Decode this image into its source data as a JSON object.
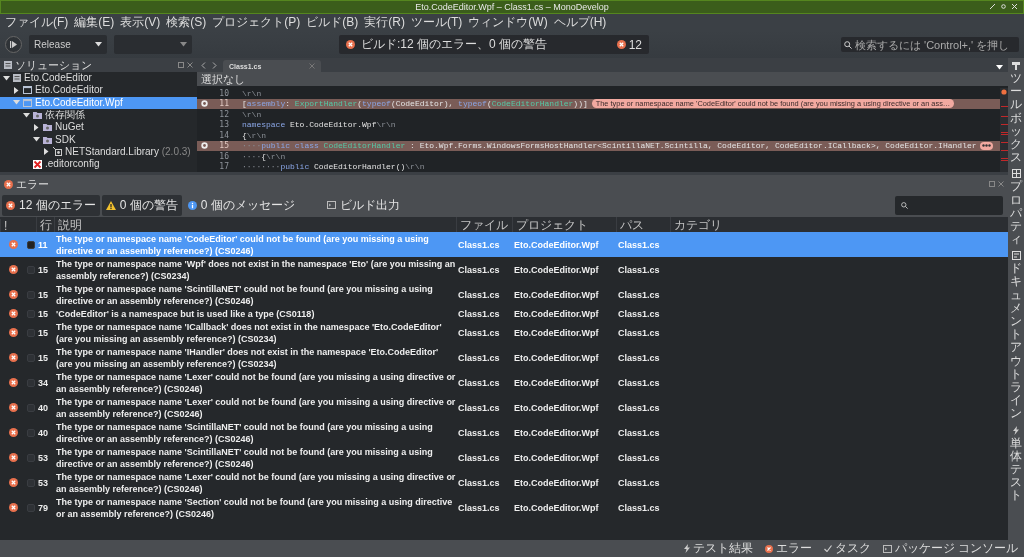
{
  "window": {
    "title": "Eto.CodeEditor.Wpf – Class1.cs – MonoDevelop"
  },
  "menu": [
    "ファイル(F)",
    "編集(E)",
    "表示(V)",
    "検索(S)",
    "プロジェクト(P)",
    "ビルド(B)",
    "実行(R)",
    "ツール(T)",
    "ウィンドウ(W)",
    "ヘルプ(H)"
  ],
  "toolbar": {
    "configuration": "Release",
    "status": {
      "text": "ビルド:12 個のエラー、0 個の警告",
      "error_count": "12"
    },
    "search": {
      "placeholder": "検索するには 'Control+,' を押し"
    }
  },
  "solution_pad": {
    "title": "ソリューション",
    "tree": [
      {
        "label": "Eto.CodeEditor",
        "kind": "solution",
        "expanded": true,
        "selected": false,
        "children": [
          {
            "label": "Eto.CodeEditor",
            "kind": "project",
            "expanded": false,
            "selected": false
          },
          {
            "label": "Eto.CodeEditor.Wpf",
            "kind": "project",
            "expanded": true,
            "selected": true,
            "children": [
              {
                "label": "依存関係",
                "kind": "folder",
                "expanded": true,
                "selected": false,
                "children": [
                  {
                    "label": "NuGet",
                    "kind": "folder",
                    "expanded": false,
                    "selected": false
                  },
                  {
                    "label": "SDK",
                    "kind": "folder",
                    "expanded": true,
                    "selected": false,
                    "children": [
                      {
                        "label": "NETStandard.Library",
                        "version": "(2.0.3)",
                        "kind": "package",
                        "expanded": false,
                        "selected": false
                      }
                    ]
                  }
                ]
              },
              {
                "label": ".editorconfig",
                "kind": "file",
                "selected": false
              }
            ]
          }
        ]
      }
    ]
  },
  "editor": {
    "tabs": [
      {
        "label": "Class1.cs",
        "selected": true
      }
    ],
    "breadcrumb": "選択なし",
    "lines": [
      {
        "number": "10",
        "error": false,
        "tokens": [
          {
            "text": "\\r\\n",
            "kind": "eol"
          }
        ]
      },
      {
        "number": "11",
        "error": true,
        "tokens": [
          {
            "text": "[",
            "kind": "plain"
          },
          {
            "text": "assembly",
            "kind": "kw"
          },
          {
            "text": ": ",
            "kind": "plain"
          },
          {
            "text": "ExportHandler",
            "kind": "type"
          },
          {
            "text": "(",
            "kind": "plain"
          },
          {
            "text": "typeof",
            "kind": "kw"
          },
          {
            "text": "(CodeEditor), ",
            "kind": "plain"
          },
          {
            "text": "typeof",
            "kind": "kw"
          },
          {
            "text": "(",
            "kind": "plain"
          },
          {
            "text": "CodeEditorHandler",
            "kind": "type"
          },
          {
            "text": "))]",
            "kind": "plain"
          }
        ],
        "bubble": {
          "collapsed": false,
          "text": "The type or namespace name 'CodeEditor' could not be found (are you missing a using directive or an ass…"
        }
      },
      {
        "number": "12",
        "error": false,
        "tokens": [
          {
            "text": "\\r\\n",
            "kind": "eol"
          }
        ]
      },
      {
        "number": "13",
        "error": false,
        "tokens": [
          {
            "text": "namespace",
            "kind": "kw"
          },
          {
            "text": " Eto.CodeEditor.Wpf",
            "kind": "plain"
          },
          {
            "text": "\\r\\n",
            "kind": "eol"
          }
        ]
      },
      {
        "number": "14",
        "error": false,
        "tokens": [
          {
            "text": "{",
            "kind": "plain"
          },
          {
            "text": "\\r\\n",
            "kind": "eol"
          }
        ]
      },
      {
        "number": "15",
        "error": true,
        "tokens": [
          {
            "text": "····",
            "kind": "ws"
          },
          {
            "text": "public class",
            "kind": "kw"
          },
          {
            "text": " CodeEditorHandler",
            "kind": "type"
          },
          {
            "text": " : Eto.Wpf.Forms.WindowsFormsHostHandler<ScintillaNET.Scintilla, CodeEditor, CodeEditor.ICallback>, CodeEditor.IHandler",
            "kind": "plain"
          }
        ],
        "bubble": {
          "collapsed": true
        }
      },
      {
        "number": "16",
        "error": false,
        "tokens": [
          {
            "text": "····",
            "kind": "ws"
          },
          {
            "text": "{",
            "kind": "plain"
          },
          {
            "text": "\\r\\n",
            "kind": "eol"
          }
        ]
      },
      {
        "number": "17",
        "error": false,
        "tokens": [
          {
            "text": "········",
            "kind": "ws"
          },
          {
            "text": "public",
            "kind": "kw"
          },
          {
            "text": " CodeEditorHandler()",
            "kind": "plain"
          },
          {
            "text": "\\r\\n",
            "kind": "eol"
          }
        ]
      }
    ]
  },
  "errors_pad": {
    "title": "エラー",
    "filters": [
      {
        "label": "12 個のエラー",
        "kind": "error",
        "selected": true
      },
      {
        "label": "0 個の警告",
        "kind": "warning",
        "selected": true
      },
      {
        "label": "0 個のメッセージ",
        "kind": "info",
        "selected": false
      }
    ],
    "build_output": "ビルド出力",
    "columns": [
      "!",
      "行",
      "説明",
      "ファイル",
      "プロジェクト",
      "パス",
      "カテゴリ"
    ],
    "rows": [
      {
        "line": "11",
        "description": "The type or namespace name 'CodeEditor' could not be found (are you missing a using directive or an assembly reference?) (CS0246)",
        "file": "Class1.cs",
        "project": "Eto.CodeEditor.Wpf",
        "path": "Class1.cs",
        "checked": false,
        "selected": true
      },
      {
        "line": "15",
        "description": "The type or namespace name 'Wpf' does not exist in the namespace 'Eto' (are you missing an assembly reference?) (CS0234)",
        "file": "Class1.cs",
        "project": "Eto.CodeEditor.Wpf",
        "path": "Class1.cs",
        "checked": false,
        "selected": false
      },
      {
        "line": "15",
        "description": "The type or namespace name 'ScintillaNET' could not be found (are you missing a using directive or an assembly reference?) (CS0246)",
        "file": "Class1.cs",
        "project": "Eto.CodeEditor.Wpf",
        "path": "Class1.cs",
        "checked": false,
        "selected": false
      },
      {
        "line": "15",
        "description": "'CodeEditor' is a namespace but is used like a type (CS0118)",
        "file": "Class1.cs",
        "project": "Eto.CodeEditor.Wpf",
        "path": "Class1.cs",
        "checked": false,
        "selected": false
      },
      {
        "line": "15",
        "description": "The type or namespace name 'ICallback' does not exist in the namespace 'Eto.CodeEditor' (are you missing an assembly reference?) (CS0234)",
        "file": "Class1.cs",
        "project": "Eto.CodeEditor.Wpf",
        "path": "Class1.cs",
        "checked": false,
        "selected": false
      },
      {
        "line": "15",
        "description": "The type or namespace name 'IHandler' does not exist in the namespace 'Eto.CodeEditor' (are you missing an assembly reference?) (CS0234)",
        "file": "Class1.cs",
        "project": "Eto.CodeEditor.Wpf",
        "path": "Class1.cs",
        "checked": false,
        "selected": false
      },
      {
        "line": "34",
        "description": "The type or namespace name 'Lexer' could not be found (are you missing a using directive or an assembly reference?) (CS0246)",
        "file": "Class1.cs",
        "project": "Eto.CodeEditor.Wpf",
        "path": "Class1.cs",
        "checked": false,
        "selected": false
      },
      {
        "line": "40",
        "description": "The type or namespace name 'Lexer' could not be found (are you missing a using directive or an assembly reference?) (CS0246)",
        "file": "Class1.cs",
        "project": "Eto.CodeEditor.Wpf",
        "path": "Class1.cs",
        "checked": false,
        "selected": false
      },
      {
        "line": "40",
        "description": "The type or namespace name 'ScintillaNET' could not be found (are you missing a using directive or an assembly reference?) (CS0246)",
        "file": "Class1.cs",
        "project": "Eto.CodeEditor.Wpf",
        "path": "Class1.cs",
        "checked": false,
        "selected": false
      },
      {
        "line": "53",
        "description": "The type or namespace name 'ScintillaNET' could not be found (are you missing a using directive or an assembly reference?) (CS0246)",
        "file": "Class1.cs",
        "project": "Eto.CodeEditor.Wpf",
        "path": "Class1.cs",
        "checked": false,
        "selected": false
      },
      {
        "line": "53",
        "description": "The type or namespace name 'Lexer' could not be found (are you missing a using directive or an assembly reference?) (CS0246)",
        "file": "Class1.cs",
        "project": "Eto.CodeEditor.Wpf",
        "path": "Class1.cs",
        "checked": false,
        "selected": false
      },
      {
        "line": "79",
        "description": "The type or namespace name 'Section' could not be found (are you missing a using directive or an assembly reference?) (CS0246)",
        "file": "Class1.cs",
        "project": "Eto.CodeEditor.Wpf",
        "path": "Class1.cs",
        "checked": false,
        "selected": false
      }
    ]
  },
  "right_dock": [
    {
      "label": "ツールボックス",
      "kind": "toolbox"
    },
    {
      "label": "プロパティ",
      "kind": "properties"
    },
    {
      "label": "ドキュメントアウトライン",
      "kind": "outline"
    },
    {
      "label": "単体テスト",
      "kind": "test"
    }
  ],
  "status_bar": [
    {
      "label": "テスト結果",
      "kind": "test"
    },
    {
      "label": "エラー",
      "kind": "error"
    },
    {
      "label": "タスク",
      "kind": "task"
    },
    {
      "label": "パッケージ コンソール",
      "kind": "console"
    }
  ]
}
